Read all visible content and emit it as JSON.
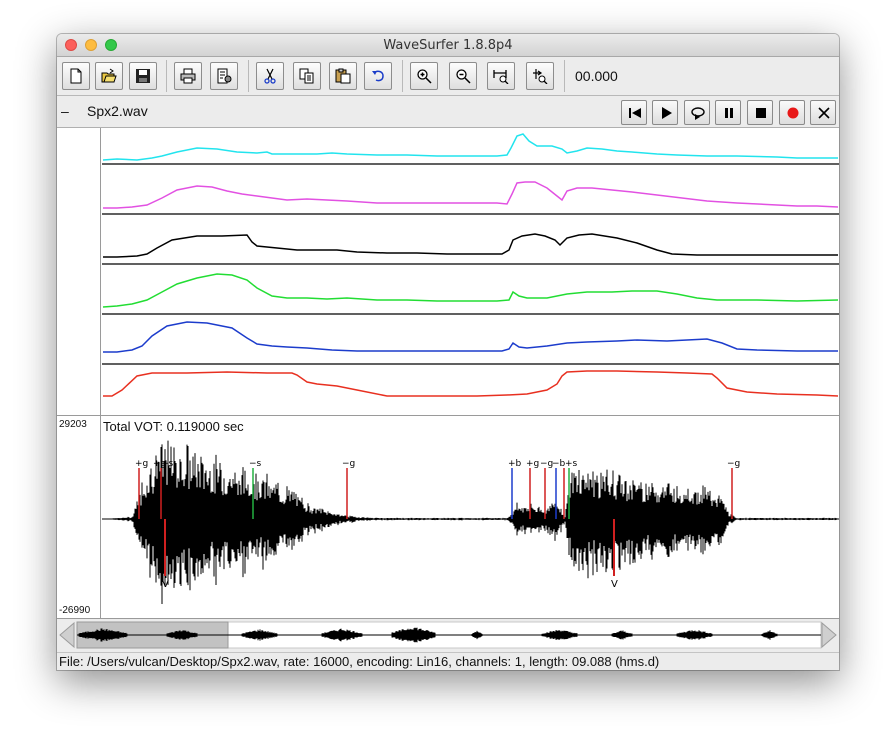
{
  "window": {
    "title": "WaveSurfer 1.8.8p4"
  },
  "toolbar": {
    "time_display": "00.000",
    "buttons": [
      {
        "id": "new",
        "icon": "new-document-icon"
      },
      {
        "id": "open",
        "icon": "open-folder-icon"
      },
      {
        "id": "save",
        "icon": "save-disk-icon"
      },
      {
        "id": "print",
        "icon": "printer-icon"
      },
      {
        "id": "properties",
        "icon": "properties-icon"
      },
      {
        "id": "cut",
        "icon": "scissors-icon"
      },
      {
        "id": "copy",
        "icon": "copy-icon"
      },
      {
        "id": "paste",
        "icon": "paste-icon"
      },
      {
        "id": "undo",
        "icon": "undo-arrow-icon"
      },
      {
        "id": "zoom-in",
        "icon": "zoom-in-icon"
      },
      {
        "id": "zoom-out",
        "icon": "zoom-out-icon"
      },
      {
        "id": "zoom-to-selection",
        "icon": "zoom-selection-icon"
      },
      {
        "id": "zoom-all",
        "icon": "zoom-all-icon"
      }
    ]
  },
  "sound": {
    "collapse": "–",
    "filename": "Spx2.wav",
    "transport": [
      {
        "id": "rewind",
        "icon": "skip-to-start-icon"
      },
      {
        "id": "play",
        "icon": "play-icon"
      },
      {
        "id": "play-loop",
        "icon": "loop-play-icon"
      },
      {
        "id": "pause",
        "icon": "pause-icon"
      },
      {
        "id": "stop",
        "icon": "stop-icon"
      },
      {
        "id": "record",
        "icon": "record-icon"
      },
      {
        "id": "close",
        "icon": "close-x-icon"
      }
    ]
  },
  "pitch_panel": {
    "track_colors": [
      "#22e4ee",
      "#e251e2",
      "#000000",
      "#22dd33",
      "#1c3ccc",
      "#e83020"
    ]
  },
  "waveform": {
    "y_max": "29203",
    "y_min": "-26990",
    "vot_text": "Total VOT: 0.119000 sec",
    "markers_top": [
      "+g",
      "+g",
      "+s",
      "−s",
      "−g",
      "+b",
      "+g",
      "−g",
      "−b",
      "+s",
      "−g"
    ],
    "marker_bottom": [
      "V",
      "V"
    ]
  },
  "status_bar": {
    "text": "File: /Users/vulcan/Desktop/Spx2.wav, rate: 16000, encoding: Lin16, channels: 1, length: 09.088 (hms.d)"
  }
}
